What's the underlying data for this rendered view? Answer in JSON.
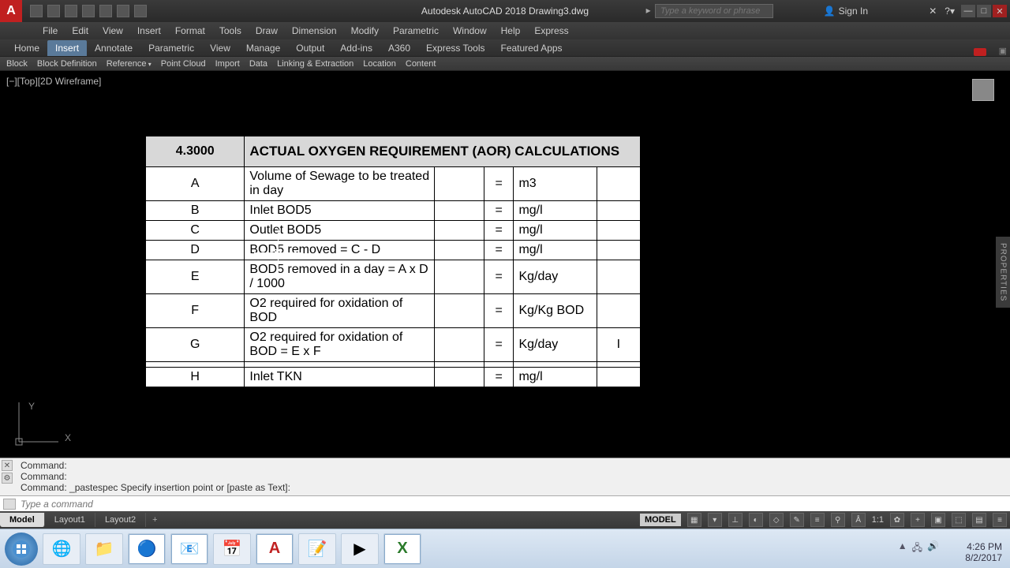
{
  "app": {
    "title": "Autodesk AutoCAD 2018    Drawing3.dwg",
    "search_placeholder": "Type a keyword or phrase",
    "signin": "Sign In"
  },
  "menu": [
    "File",
    "Edit",
    "View",
    "Insert",
    "Format",
    "Tools",
    "Draw",
    "Dimension",
    "Modify",
    "Parametric",
    "Window",
    "Help",
    "Express"
  ],
  "ribbon_tabs": [
    "Home",
    "Insert",
    "Annotate",
    "Parametric",
    "View",
    "Manage",
    "Output",
    "Add-ins",
    "A360",
    "Express Tools",
    "Featured Apps"
  ],
  "ribbon_active": 1,
  "ribbon_panels": [
    "Block",
    "Block Definition",
    "Reference",
    "Point Cloud",
    "Import",
    "Data",
    "Linking & Extraction",
    "Location",
    "Content"
  ],
  "viewport": {
    "label": "[−][Top][2D Wireframe]"
  },
  "properties_tab": "PROPERTIES",
  "table": {
    "section_num": "4.3000",
    "section_title": "ACTUAL OXYGEN REQUIREMENT (AOR) CALCULATIONS",
    "rows": [
      {
        "id": "A",
        "desc": "Volume of Sewage to be treated in day",
        "eq": "=",
        "unit": "m3",
        "val": ""
      },
      {
        "id": "B",
        "desc": "Inlet BOD5",
        "eq": "=",
        "unit": "mg/l",
        "val": ""
      },
      {
        "id": "C",
        "desc": "Outlet BOD5",
        "eq": "=",
        "unit": "mg/l",
        "val": ""
      },
      {
        "id": "D",
        "desc": "BOD5 removed = C - D",
        "eq": "=",
        "unit": "mg/l",
        "val": ""
      },
      {
        "id": "E",
        "desc": "BOD5 removed in a day = A x D / 1000",
        "eq": "=",
        "unit": "Kg/day",
        "val": ""
      },
      {
        "id": "F",
        "desc": "O2 required for oxidation of BOD",
        "eq": "=",
        "unit": "Kg/Kg BOD",
        "val": ""
      },
      {
        "id": "G",
        "desc": "O2 required for oxidation of BOD = E x F",
        "eq": "=",
        "unit": "Kg/day",
        "val": "I"
      },
      {
        "id": "",
        "desc": "",
        "eq": "",
        "unit": "",
        "val": ""
      },
      {
        "id": "H",
        "desc": "Inlet TKN",
        "eq": "=",
        "unit": "mg/l",
        "val": ""
      }
    ]
  },
  "cmd": {
    "history": [
      "Command:",
      "Command:",
      "Command: _pastespec Specify insertion point or [paste as Text]:"
    ],
    "placeholder": "Type a command"
  },
  "layout_tabs": [
    "Model",
    "Layout1",
    "Layout2"
  ],
  "layout_active": 0,
  "status": {
    "model": "MODEL",
    "scale": "1:1"
  },
  "clock": {
    "time": "4:26 PM",
    "date": "8/2/2017"
  }
}
